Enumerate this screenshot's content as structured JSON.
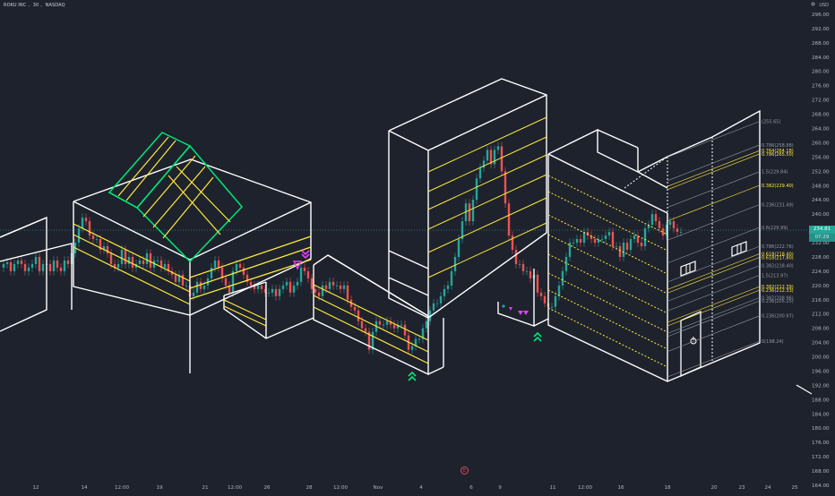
{
  "header": {
    "symbol": "ROKU INC",
    "interval": "30",
    "exchange": "NASDAQ",
    "currency": "USD"
  },
  "colors": {
    "background": "#1e222d",
    "grid": "#2a2e39",
    "up": "#26a69a",
    "down": "#ef5350",
    "drawing_white": "#ffffff",
    "drawing_yellow": "#ffeb3b",
    "drawing_green": "#00e676",
    "fib_gray": "#9598a1",
    "price_badge": "#26a69a",
    "price_badge_2": "#4c525e",
    "marker_magenta": "#e040fb",
    "marker_green": "#00e676"
  },
  "price_badges": {
    "last": "234.81",
    "countdown": "07:29"
  },
  "event_marker": {
    "label": "E"
  },
  "chart_data": {
    "type": "candlestick",
    "y_axis": {
      "ticks": [
        "296.00",
        "292.00",
        "288.00",
        "284.00",
        "280.00",
        "276.00",
        "272.00",
        "268.00",
        "264.00",
        "260.00",
        "256.00",
        "252.00",
        "248.00",
        "244.00",
        "240.00",
        "236.00",
        "232.00",
        "228.00",
        "224.00",
        "220.00",
        "216.00",
        "212.00",
        "208.00",
        "204.00",
        "200.00",
        "196.00",
        "192.00",
        "188.00",
        "184.00",
        "180.00",
        "176.00",
        "172.00",
        "168.00",
        "164.00"
      ],
      "values": [
        296,
        292,
        288,
        284,
        280,
        276,
        272,
        268,
        264,
        260,
        256,
        252,
        248,
        244,
        240,
        236,
        232,
        228,
        224,
        220,
        216,
        212,
        208,
        204,
        200,
        196,
        192,
        188,
        184,
        180,
        176,
        172,
        168,
        164
      ],
      "range": [
        164,
        298
      ]
    },
    "x_axis": {
      "ticks": [
        "12",
        "14",
        "12:00",
        "19",
        "21",
        "12:00",
        "26",
        "28",
        "12:00",
        "Nov",
        "4",
        "6",
        "9",
        "11",
        "12:00",
        "16",
        "18",
        "20",
        "23",
        "24",
        "25"
      ]
    },
    "fib_levels": [
      {
        "label": "(255.65)",
        "price": 266.0,
        "color": "#9598a1"
      },
      {
        "label": "0.786(258.88)",
        "price": 259.4,
        "color": "#9598a1"
      },
      {
        "label": "0.764(264.18)",
        "price": 257.8,
        "color": "#ffeb3b"
      },
      {
        "label": "0.786(265.50)",
        "price": 256.9,
        "color": "#ffeb3b"
      },
      {
        "label": "1.5(229.84)",
        "price": 251.9,
        "color": "#9598a1"
      },
      {
        "label": "0.382(229.40)",
        "price": 248.1,
        "color": "#ffeb3b"
      },
      {
        "label": "0.236(231.49)",
        "price": 242.7,
        "color": "#9598a1"
      },
      {
        "label": "0.6(229.99)",
        "price": 236.3,
        "color": "#9598a1"
      },
      {
        "label": "0.786(222.76)",
        "price": 231.0,
        "color": "#9598a1"
      },
      {
        "label": "0.618(218.40)",
        "price": 228.9,
        "color": "#ffeb3b"
      },
      {
        "label": "0.618(217.80)",
        "price": 227.9,
        "color": "#ffeb3b"
      },
      {
        "label": "0.382(218.40)",
        "price": 225.6,
        "color": "#9598a1"
      },
      {
        "label": "1.5(213.97)",
        "price": 222.9,
        "color": "#9598a1"
      },
      {
        "label": "0.382(212.39)",
        "price": 219.7,
        "color": "#ffeb3b"
      },
      {
        "label": "0.236(212.33)",
        "price": 218.7,
        "color": "#ffeb3b"
      },
      {
        "label": "0.382(208.96)",
        "price": 216.6,
        "color": "#9598a1"
      },
      {
        "label": "0.236(205.25)",
        "price": 215.7,
        "color": "#9598a1"
      },
      {
        "label": "0.236(200.97)",
        "price": 211.5,
        "color": "#9598a1"
      },
      {
        "label": "0(198.24)",
        "price": 204.4,
        "color": "#9598a1"
      }
    ],
    "price_path": [
      [
        0,
        225
      ],
      [
        4,
        226
      ],
      [
        8,
        226.5
      ],
      [
        12,
        224
      ],
      [
        16,
        226
      ],
      [
        20,
        227
      ],
      [
        24,
        226
      ],
      [
        28,
        224
      ],
      [
        32,
        225
      ],
      [
        36,
        226
      ],
      [
        40,
        228
      ],
      [
        44,
        224
      ],
      [
        48,
        226
      ],
      [
        52,
        226
      ],
      [
        56,
        224
      ],
      [
        60,
        227
      ],
      [
        64,
        225
      ],
      [
        68,
        224
      ],
      [
        72,
        227
      ],
      [
        76,
        226
      ],
      [
        80,
        229
      ],
      [
        84,
        232
      ],
      [
        88,
        236
      ],
      [
        92,
        239
      ],
      [
        96,
        238
      ],
      [
        100,
        234
      ],
      [
        104,
        233
      ],
      [
        108,
        233
      ],
      [
        112,
        230
      ],
      [
        116,
        231
      ],
      [
        120,
        229
      ],
      [
        124,
        226
      ],
      [
        128,
        225
      ],
      [
        132,
        226
      ],
      [
        136,
        230
      ],
      [
        140,
        226
      ],
      [
        144,
        228
      ],
      [
        148,
        225
      ],
      [
        152,
        226
      ],
      [
        156,
        227
      ],
      [
        160,
        226
      ],
      [
        164,
        229
      ],
      [
        168,
        225
      ],
      [
        172,
        227
      ],
      [
        176,
        227
      ],
      [
        180,
        225
      ],
      [
        184,
        226
      ],
      [
        188,
        224
      ],
      [
        192,
        223
      ],
      [
        196,
        221
      ],
      [
        200,
        223
      ],
      [
        204,
        220
      ],
      [
        208,
        220
      ],
      [
        212,
        217
      ],
      [
        216,
        218
      ],
      [
        220,
        221
      ],
      [
        224,
        219
      ],
      [
        228,
        220
      ],
      [
        232,
        222
      ],
      [
        236,
        225
      ],
      [
        240,
        227
      ],
      [
        244,
        225
      ],
      [
        248,
        222
      ],
      [
        252,
        220
      ],
      [
        256,
        218
      ],
      [
        260,
        224
      ],
      [
        264,
        226
      ],
      [
        268,
        225
      ],
      [
        272,
        223
      ],
      [
        276,
        221
      ],
      [
        280,
        220
      ],
      [
        284,
        219
      ],
      [
        288,
        220
      ],
      [
        292,
        219
      ],
      [
        296,
        218
      ],
      [
        300,
        218
      ],
      [
        304,
        219
      ],
      [
        308,
        217
      ],
      [
        312,
        219
      ],
      [
        316,
        220
      ],
      [
        320,
        221
      ],
      [
        324,
        218
      ],
      [
        328,
        220
      ],
      [
        332,
        221
      ],
      [
        336,
        225
      ],
      [
        340,
        224
      ],
      [
        344,
        222
      ],
      [
        348,
        219
      ],
      [
        352,
        218
      ],
      [
        356,
        217
      ],
      [
        360,
        220
      ],
      [
        364,
        219
      ],
      [
        368,
        221
      ],
      [
        372,
        220
      ],
      [
        376,
        220
      ],
      [
        380,
        219
      ],
      [
        384,
        220
      ],
      [
        388,
        216
      ],
      [
        392,
        214
      ],
      [
        396,
        213
      ],
      [
        400,
        210
      ],
      [
        404,
        208
      ],
      [
        408,
        207
      ],
      [
        412,
        202
      ],
      [
        416,
        207
      ],
      [
        420,
        210
      ],
      [
        424,
        209
      ],
      [
        428,
        209
      ],
      [
        432,
        210
      ],
      [
        436,
        209
      ],
      [
        440,
        208
      ],
      [
        444,
        209
      ],
      [
        448,
        209
      ],
      [
        452,
        206
      ],
      [
        456,
        202
      ],
      [
        460,
        203
      ],
      [
        464,
        205
      ],
      [
        468,
        205
      ],
      [
        472,
        208
      ],
      [
        476,
        210
      ],
      [
        480,
        213
      ],
      [
        484,
        215
      ],
      [
        488,
        215
      ],
      [
        492,
        217
      ],
      [
        496,
        219
      ],
      [
        500,
        220
      ],
      [
        504,
        224
      ],
      [
        508,
        228
      ],
      [
        512,
        233
      ],
      [
        516,
        238
      ],
      [
        520,
        243
      ],
      [
        524,
        238
      ],
      [
        528,
        244
      ],
      [
        532,
        250
      ],
      [
        536,
        253
      ],
      [
        540,
        255
      ],
      [
        544,
        258
      ],
      [
        548,
        254
      ],
      [
        552,
        258
      ],
      [
        556,
        259
      ],
      [
        560,
        252
      ],
      [
        564,
        243
      ],
      [
        568,
        234
      ],
      [
        572,
        230
      ],
      [
        576,
        226
      ],
      [
        580,
        226
      ],
      [
        584,
        224
      ],
      [
        588,
        224
      ],
      [
        592,
        222
      ],
      [
        596,
        223
      ],
      [
        600,
        218
      ],
      [
        604,
        217
      ],
      [
        608,
        215
      ],
      [
        612,
        214
      ],
      [
        616,
        214
      ],
      [
        620,
        217
      ],
      [
        624,
        220
      ],
      [
        628,
        224
      ],
      [
        632,
        228
      ],
      [
        636,
        232
      ],
      [
        640,
        232
      ],
      [
        644,
        233
      ],
      [
        648,
        232
      ],
      [
        652,
        235
      ],
      [
        656,
        234
      ],
      [
        660,
        233
      ],
      [
        664,
        232
      ],
      [
        668,
        233
      ],
      [
        672,
        233
      ],
      [
        676,
        234
      ],
      [
        680,
        235
      ],
      [
        684,
        231
      ],
      [
        688,
        231
      ],
      [
        692,
        228
      ],
      [
        696,
        232
      ],
      [
        700,
        230
      ],
      [
        704,
        233
      ],
      [
        708,
        234
      ],
      [
        712,
        232
      ],
      [
        716,
        231
      ],
      [
        720,
        236
      ],
      [
        724,
        237
      ],
      [
        728,
        240
      ],
      [
        732,
        238
      ],
      [
        736,
        236
      ],
      [
        740,
        234
      ],
      [
        744,
        237
      ],
      [
        748,
        238
      ],
      [
        752,
        236
      ],
      [
        756,
        235
      ],
      [
        760,
        235
      ]
    ]
  }
}
